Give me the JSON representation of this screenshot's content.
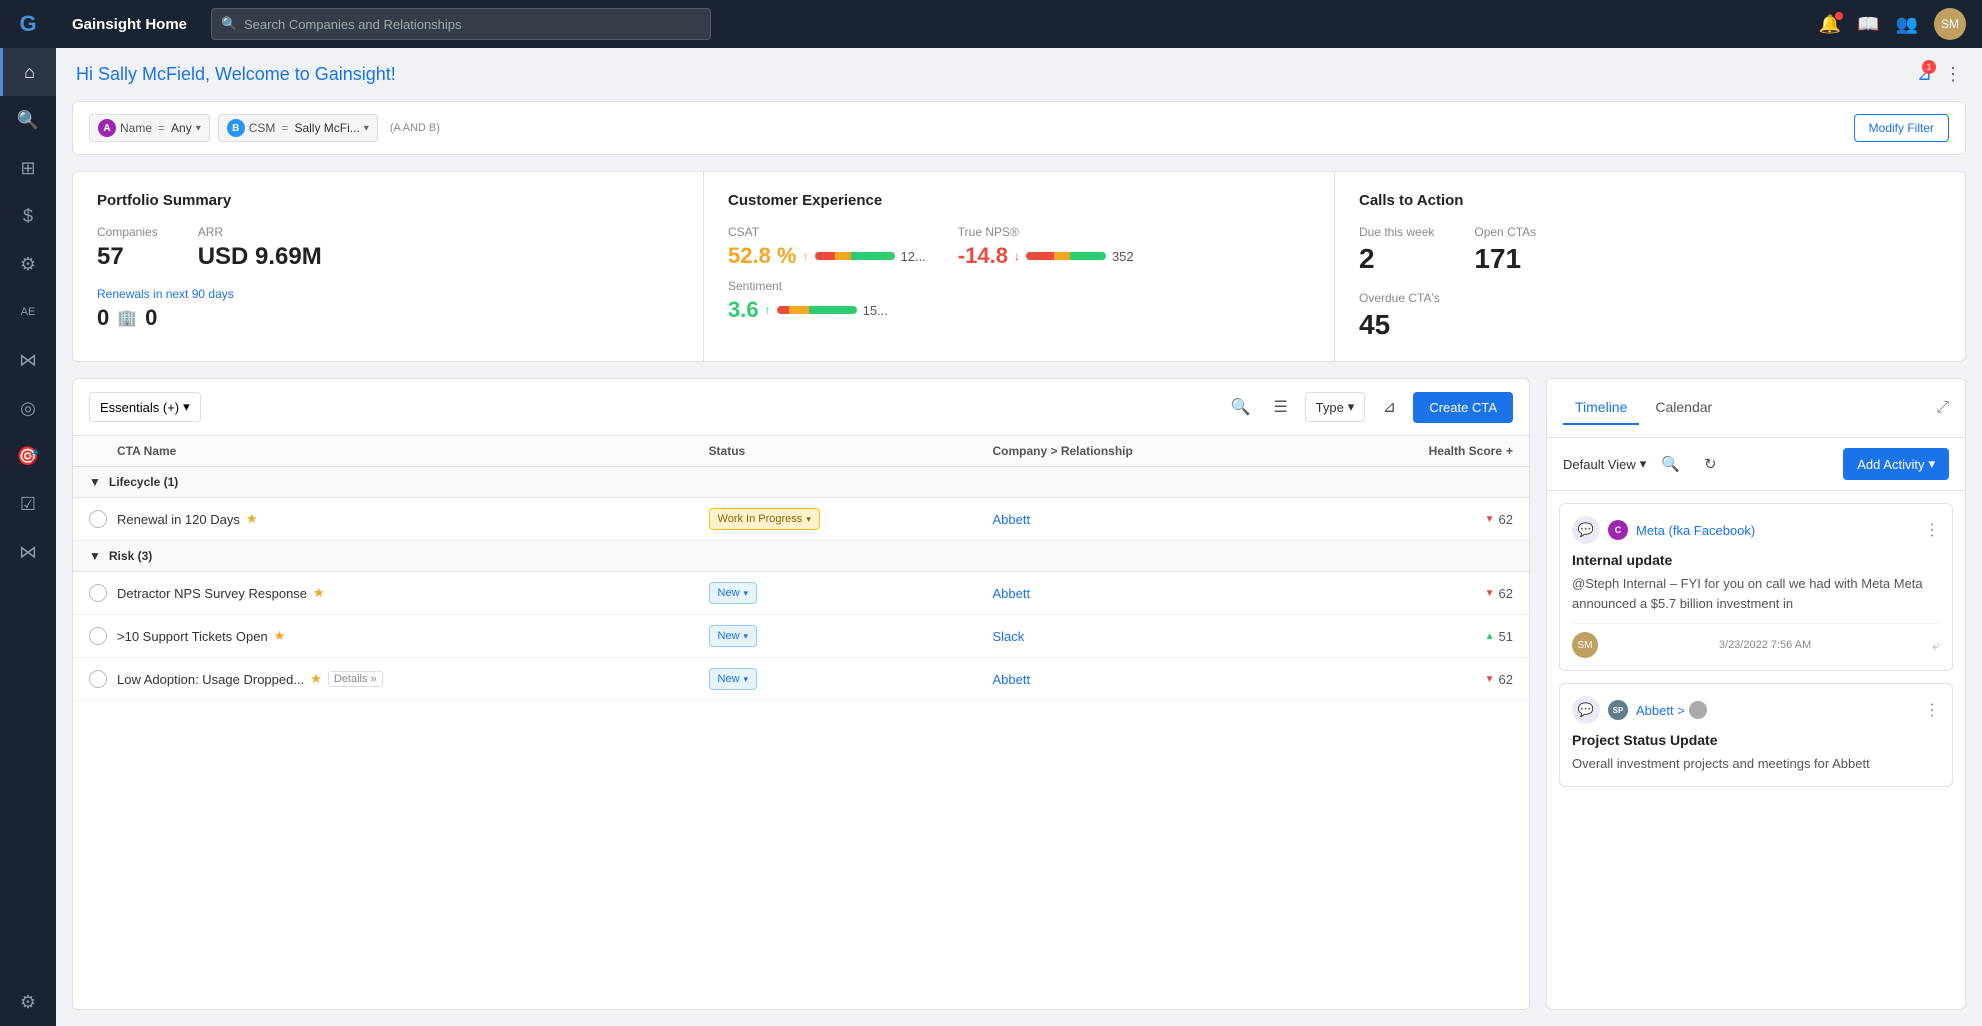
{
  "app": {
    "title": "Gainsight Home",
    "search_placeholder": "Search Companies and Relationships"
  },
  "topnav": {
    "title": "Gainsight Home"
  },
  "sidebar": {
    "items": [
      {
        "id": "home",
        "icon": "⌂",
        "label": "Home",
        "active": true
      },
      {
        "id": "dashboard",
        "icon": "⊞",
        "label": "Dashboard"
      },
      {
        "id": "revenue",
        "icon": "$",
        "label": "Revenue"
      },
      {
        "id": "settings",
        "icon": "⚙",
        "label": "Settings"
      },
      {
        "id": "ae",
        "icon": "AE",
        "label": "AE"
      },
      {
        "id": "network",
        "icon": "⋈",
        "label": "Network"
      },
      {
        "id": "camera",
        "icon": "◎",
        "label": "Camera"
      },
      {
        "id": "target",
        "icon": "◎",
        "label": "Target"
      },
      {
        "id": "tasks",
        "icon": "☑",
        "label": "Tasks"
      },
      {
        "id": "connect",
        "icon": "⋈",
        "label": "Connect"
      },
      {
        "id": "gear",
        "icon": "⚙",
        "label": "Gear"
      }
    ]
  },
  "page": {
    "greeting": "Hi Sally McField, Welcome to Gainsight!"
  },
  "filters": {
    "a_label": "A",
    "a_field": "Name",
    "a_op": "=",
    "a_value": "Any",
    "b_label": "B",
    "b_field": "CSM",
    "b_op": "=",
    "b_value": "Sally McFi...",
    "logic": "(A AND B)",
    "modify_btn": "Modify Filter"
  },
  "portfolio": {
    "title": "Portfolio Summary",
    "companies_label": "Companies",
    "companies_value": "57",
    "arr_label": "ARR",
    "arr_value": "USD 9.69M",
    "renewals_label": "Renewals in next 90 days",
    "renewals_value": "0",
    "renewals_icon": "🏢"
  },
  "customer_experience": {
    "title": "Customer Experience",
    "csat_label": "CSAT",
    "csat_value": "52.8 %",
    "csat_count": "12...",
    "nps_label": "True NPS®",
    "nps_value": "-14.8",
    "nps_count": "352",
    "sentiment_label": "Sentiment",
    "sentiment_value": "3.6",
    "sentiment_count": "15..."
  },
  "calls_to_action": {
    "title": "Calls to Action",
    "due_week_label": "Due this week",
    "due_week_value": "2",
    "open_ctas_label": "Open CTAs",
    "open_ctas_value": "171",
    "overdue_label": "Overdue CTA's",
    "overdue_value": "45"
  },
  "cta_panel": {
    "essentials_label": "Essentials (+)",
    "type_label": "Type",
    "create_btn": "Create CTA",
    "col_name": "CTA Name",
    "col_status": "Status",
    "col_company": "Company > Relationship",
    "col_health": "Health Score",
    "groups": [
      {
        "name": "Lifecycle (1)",
        "rows": [
          {
            "name": "Renewal in 120 Days",
            "starred": true,
            "status": "Work In Progress",
            "status_type": "wip",
            "company": "Abbett",
            "health_arrow": "down",
            "health": "62",
            "details": false
          }
        ]
      },
      {
        "name": "Risk (3)",
        "rows": [
          {
            "name": "Detractor NPS Survey Response",
            "starred": true,
            "status": "New",
            "status_type": "new",
            "company": "Abbett",
            "health_arrow": "down",
            "health": "62",
            "details": false
          },
          {
            "name": ">10 Support Tickets Open",
            "starred": true,
            "status": "New",
            "status_type": "new",
            "company": "Slack",
            "health_arrow": "up",
            "health": "51",
            "details": false
          },
          {
            "name": "Low Adoption: Usage Dropped...",
            "starred": true,
            "status": "New",
            "status_type": "new",
            "company": "Abbett",
            "health_arrow": "down",
            "health": "62",
            "details": true
          }
        ]
      }
    ]
  },
  "timeline": {
    "tabs": [
      "Timeline",
      "Calendar"
    ],
    "active_tab": "Timeline",
    "view_label": "Default View",
    "add_activity_btn": "Add Activity",
    "cards": [
      {
        "type": "C",
        "type_class": "c",
        "company": "Meta (fka Facebook)",
        "title": "Internal update",
        "body": "@Steph Internal – FYI for you on call we had with Meta Meta announced a $5.7 billion investment in",
        "date": "3/23/2022 7:56 AM",
        "has_reply": true
      },
      {
        "type": "SP",
        "type_class": "sp",
        "company": "Abbett >",
        "title": "Project Status Update",
        "body": "Overall investment projects and meetings for Abbett",
        "date": "",
        "has_reply": false
      }
    ]
  }
}
